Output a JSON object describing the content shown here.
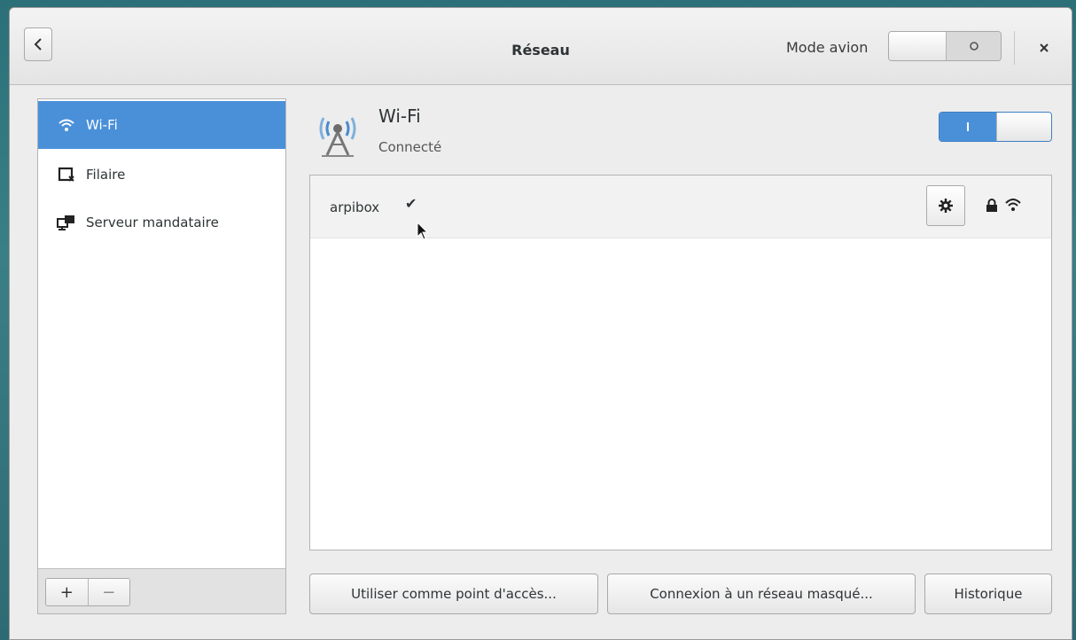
{
  "window": {
    "title": "Réseau"
  },
  "airplane_mode": {
    "label": "Mode avion",
    "state_symbol": "O",
    "on": false
  },
  "sidebar": {
    "items": [
      {
        "label": "Wi-Fi",
        "icon": "wifi-icon",
        "active": true
      },
      {
        "label": "Filaire",
        "icon": "wired-icon",
        "active": false
      },
      {
        "label": "Serveur mandataire",
        "icon": "proxy-icon",
        "active": false
      }
    ],
    "toolbar": {
      "add_label": "+",
      "remove_label": "−"
    }
  },
  "device": {
    "name": "Wi-Fi",
    "status": "Connecté",
    "switch_symbol": "I",
    "on": true
  },
  "networks": [
    {
      "name": "arpibox",
      "connected_mark": "✔",
      "secured": true
    }
  ],
  "buttons": {
    "hotspot": "Utiliser comme point d'accès...",
    "hidden": "Connexion à un réseau masqué...",
    "history": "Historique"
  },
  "colors": {
    "accent": "#4a90d9",
    "background": "#2e6a73"
  }
}
